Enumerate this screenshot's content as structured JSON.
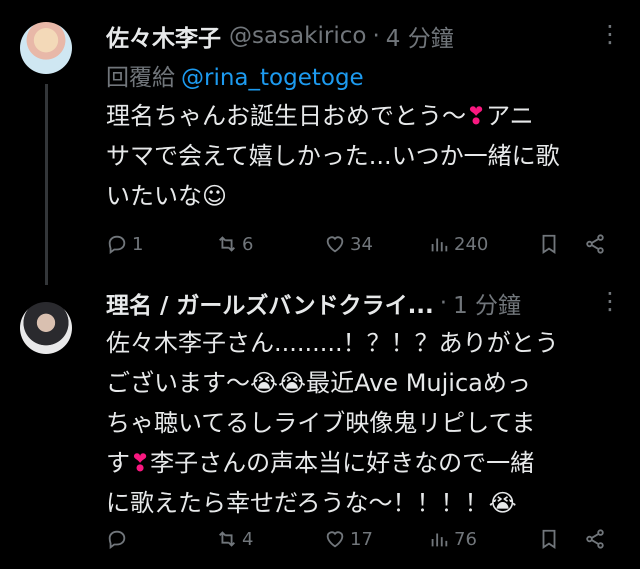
{
  "tweets": [
    {
      "name": "佐々木李子",
      "handle": "@sasakirico",
      "separator": "·",
      "time": "4 分鐘",
      "reply_to_label": "回覆給",
      "reply_to_handle": "@rina_togetoge",
      "lines": [
        {
          "text": "理名ちゃんお誕生日おめでとう〜",
          "tail_heart": "❣",
          "tail_text": "アニ"
        },
        {
          "text": "サマで会えて嬉しかった...いつか一緒に歌"
        },
        {
          "text": "いたいな☺"
        }
      ],
      "actions": {
        "replies": "1",
        "retweets": "6",
        "likes": "34",
        "views": "240"
      }
    },
    {
      "name": "理名 / ガールズバンドクライ...",
      "separator": "·",
      "time": "1 分鐘",
      "lines": [
        {
          "text": "佐々木李子さん.........！？！？ありがとう"
        },
        {
          "text": "ございます〜",
          "emoji": "😭😭",
          "tail_text": "最近Ave Mujicaめっ"
        },
        {
          "text": "ちゃ聴いてるしライブ映像鬼リピしてま"
        },
        {
          "text": "す",
          "heart": "❣",
          "tail_text": "李子さんの声本当に好きなので一緒"
        },
        {
          "text": "に歌えたら幸せだろうな〜！！！！",
          "end_emoji": "😭"
        }
      ],
      "actions": {
        "replies": "",
        "retweets": "4",
        "likes": "17",
        "views": "76"
      }
    }
  ],
  "icons": [
    "reply-icon",
    "retweet-icon",
    "like-icon",
    "views-icon",
    "bookmark-icon",
    "share-icon",
    "more-icon"
  ],
  "colors": {
    "background": "#000000",
    "text": "#e7e9ea",
    "muted": "#71767b",
    "link": "#1d9bf0",
    "heart": "#f91880"
  }
}
